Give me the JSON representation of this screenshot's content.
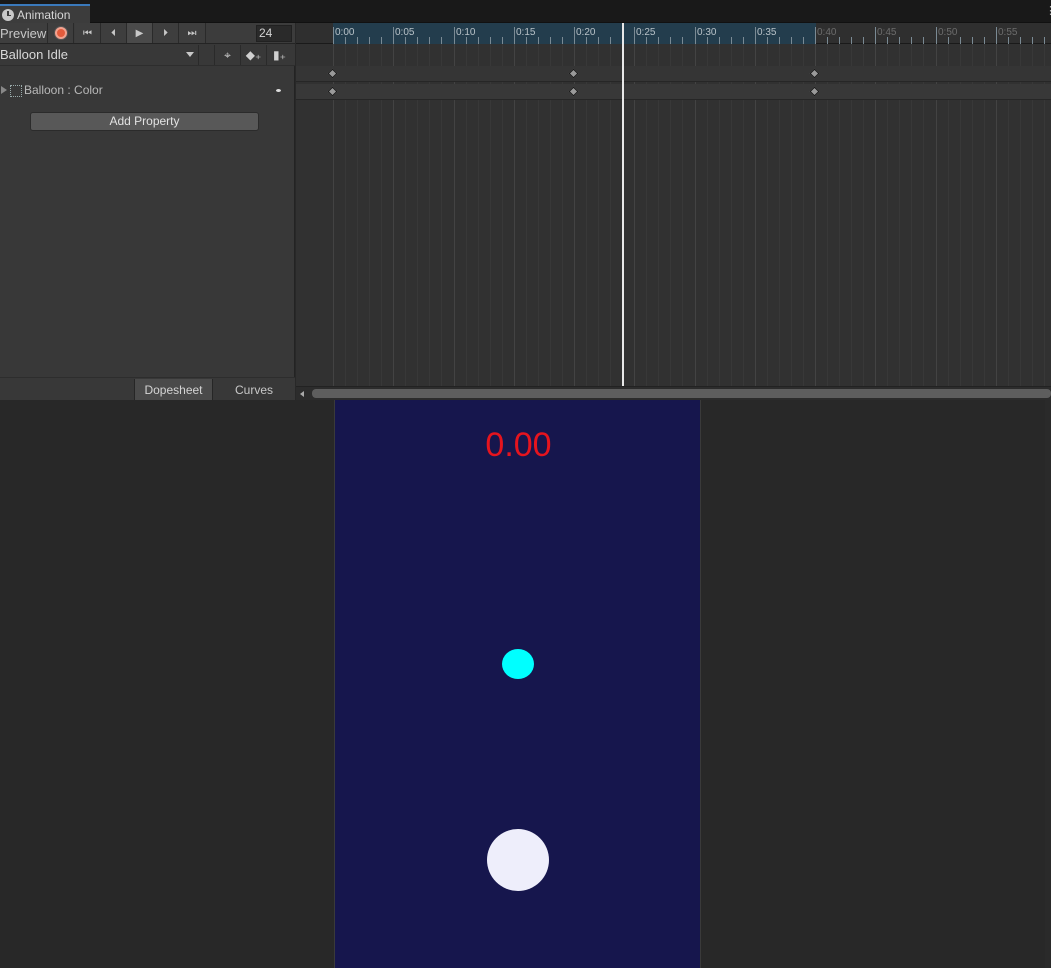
{
  "tabs": [
    {
      "label": "Animation",
      "icon": "clock-icon"
    }
  ],
  "toolbar": {
    "preview_label": "Preview",
    "record_icon": "record-icon",
    "first_icon": "first-key-icon",
    "prev_icon": "prev-key-icon",
    "play_icon": "play-icon",
    "next_icon": "next-key-icon",
    "last_icon": "last-key-icon",
    "frame_value": "24"
  },
  "clip": {
    "selected": "Balloon Idle"
  },
  "clip_tools": {
    "keyframe_icon": "keyframe-target-icon",
    "add_key_icon": "add-keyframe-icon",
    "add_event_icon": "add-event-icon"
  },
  "properties": [
    {
      "label": "Balloon : Color",
      "icon": "sprite-renderer-icon"
    }
  ],
  "add_property_label": "Add Property",
  "view_tabs": {
    "dopesheet": "Dopesheet",
    "curves": "Curves",
    "active": "dopesheet"
  },
  "timeline": {
    "ruler_labels": [
      "0:00",
      "0:05",
      "0:10",
      "0:15",
      "0:20",
      "0:25",
      "0:30",
      "0:35",
      "0:40",
      "0:45",
      "0:50",
      "0:55"
    ],
    "clip_end_label": "0:40",
    "keyframes": [
      "0:00",
      "0:20",
      "0:40"
    ],
    "playhead": "0:24"
  },
  "game": {
    "timer_text": "0.00",
    "background_color": "#16164d",
    "timer_color": "#e5141e",
    "small_ball_color": "#00ffff",
    "big_ball_color": "#eeeefb"
  }
}
